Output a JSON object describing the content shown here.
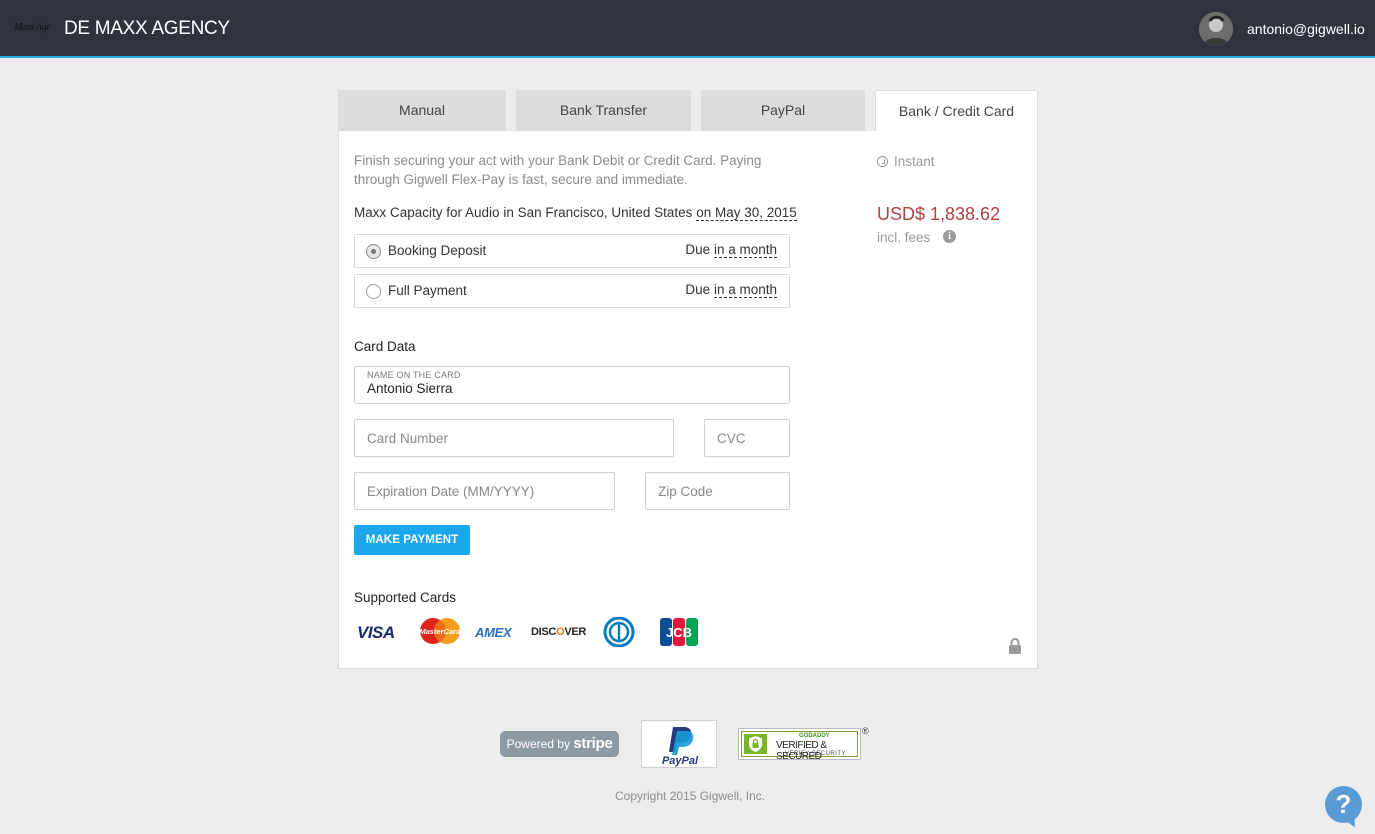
{
  "topbar": {
    "logo_text": "Maxx Age",
    "brand": "DE MAXX AGENCY",
    "user_email": "antonio@gigwell.io"
  },
  "tabs": [
    {
      "label": "Manual",
      "active": false
    },
    {
      "label": "Bank Transfer",
      "active": false
    },
    {
      "label": "PayPal",
      "active": false
    },
    {
      "label": "Bank / Credit Card",
      "active": true
    }
  ],
  "payment": {
    "intro": "Finish securing your act with your Bank Debit or Credit Card. Paying through Gigwell Flex-Pay is fast, secure and immediate.",
    "event_name": "Maxx Capacity for Audio in San Francisco, United States",
    "event_on": "on",
    "event_date": "May 30, 2015",
    "options": [
      {
        "label": "Booking Deposit",
        "due_prefix": "Due",
        "due": "in a month",
        "selected": true
      },
      {
        "label": "Full Payment",
        "due_prefix": "Due",
        "due": "in a month",
        "selected": false
      }
    ],
    "card_data_title": "Card Data",
    "name_field": {
      "label": "NAME ON THE CARD",
      "value": "Antonio Sierra"
    },
    "card_number_placeholder": "Card Number",
    "cvc_placeholder": "CVC",
    "expiration_placeholder": "Expiration Date (MM/YYYY)",
    "zip_placeholder": "Zip Code",
    "submit_label": "MAKE PAYMENT",
    "supported_cards_title": "Supported Cards",
    "cards": {
      "visa": "VISA",
      "mastercard": "MasterCard",
      "amex": "AMEX",
      "discover_pre": "DISC",
      "discover_o": "O",
      "discover_post": "VER",
      "jcb": "JCB"
    }
  },
  "summary": {
    "speed": "Instant",
    "amount": "USD$ 1,838.62",
    "fees_note": "incl. fees",
    "info_icon": "i"
  },
  "footer": {
    "stripe_prefix": "Powered by",
    "stripe_name": "stripe",
    "paypal_label": "PayPal",
    "godaddy_top": "GODADDY",
    "godaddy_main": "VERIFIED & SECURED",
    "godaddy_sub": "VERIFY SECURITY",
    "registered": "®",
    "copyright": "Copyright 2015 Gigwell, Inc.",
    "help": "?"
  },
  "colors": {
    "topbar_bg": "#2f333b",
    "accent_blue": "#27a9e1",
    "button_blue": "#1aa7ec",
    "price_red": "#b0413e",
    "page_bg": "#ececec"
  }
}
